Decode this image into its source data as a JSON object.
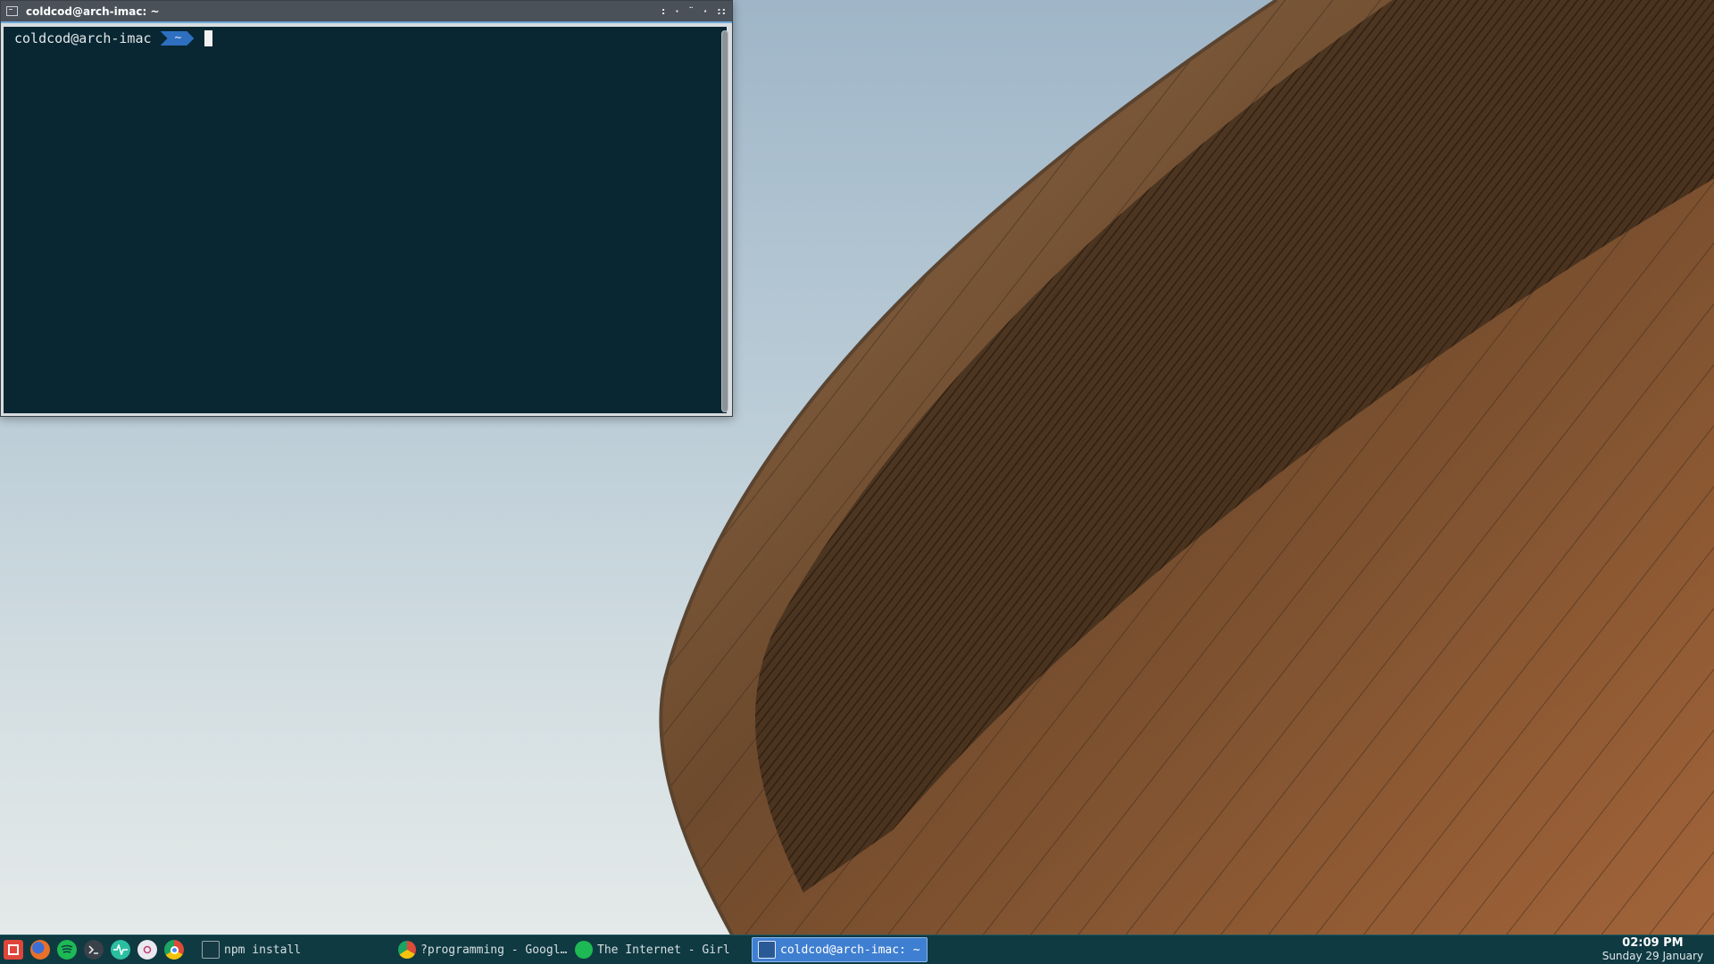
{
  "terminal": {
    "title": "coldcod@arch-imac: ~",
    "window_controls": [
      ":",
      "·",
      "¨",
      "·",
      "::"
    ],
    "prompt_user": "coldcod@arch-imac",
    "prompt_dir": "~"
  },
  "taskbar": {
    "launchers": [
      {
        "icon": "app-menu-icon",
        "color": "#e0453b"
      },
      {
        "icon": "firefox-icon",
        "color": "#e8702a"
      },
      {
        "icon": "spotify-icon",
        "color": "#1db954"
      },
      {
        "icon": "terminal-icon",
        "color": "#3a4148"
      },
      {
        "icon": "system-monitor-icon",
        "color": "#2bbfa1"
      },
      {
        "icon": "settings-icon",
        "color": "#e9e9ef"
      },
      {
        "icon": "chrome-icon",
        "color": "#dd4b39"
      }
    ],
    "tasks": [
      {
        "label": "npm install",
        "icon": "terminal-icon"
      },
      {
        "label": "?programming - Googl…",
        "icon": "chrome-icon"
      },
      {
        "label": "The Internet - Girl",
        "icon": "spotify-icon"
      },
      {
        "label": "coldcod@arch-imac: ~",
        "icon": "terminal-icon",
        "active": true
      }
    ],
    "clock": {
      "time": "02:09 PM",
      "date": "Sunday 29 January"
    }
  }
}
